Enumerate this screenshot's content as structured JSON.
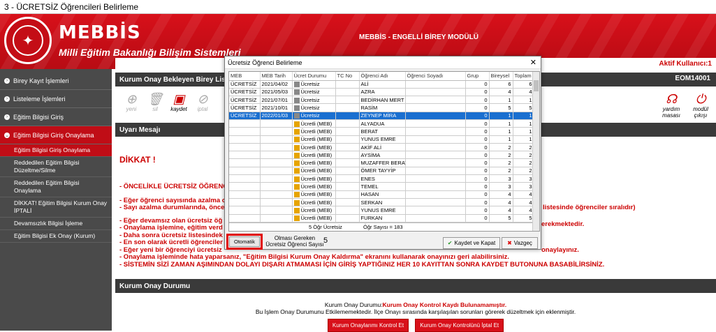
{
  "window": {
    "title": "3 - ÜCRETSİZ Öğrencileri Belirleme"
  },
  "header": {
    "brand": "MEBBİS",
    "subtitle": "Milli Eğitim Bakanlığı Bilişim Sistemleri",
    "module": "MEBBİS - ENGELLİ BİREY MODÜLÜ",
    "active_user": "Aktif Kullanıcı:1",
    "colors": {
      "header": "#d8101a",
      "sidebar": "#4a4a4a",
      "accent": "#c00d16"
    }
  },
  "sidebar": {
    "items": [
      {
        "label": "Birey Kayıt İşlemleri",
        "icon": "arrow-right-icon"
      },
      {
        "label": "Listeleme İşlemleri",
        "icon": "arrow-right-icon"
      },
      {
        "label": "Eğitim Bilgisi Giriş",
        "icon": "arrow-right-icon"
      },
      {
        "label": "Eğitim Bilgisi Giriş Onaylama",
        "icon": "arrow-down-icon"
      }
    ],
    "subitems": [
      "Eğitim Bilgisi Giriş Onaylama",
      "Reddedilen Eğitim Bilgisi Düzeltme/Silme",
      "Reddedilen Eğitim Bilgisi Onaylama",
      "DİKKAT! Eğitim Bilgisi Kurum Onay İPTALİ",
      "Devamsızlık Bilgisi İşleme",
      "Eğitim Bilgisi Ek Onay (Kurum)"
    ]
  },
  "main": {
    "panel_title": "Kurum Onay Bekleyen Birey Listesi",
    "eom_code": "EOM14001",
    "toolbar": {
      "new": "yeni",
      "delete": "sil",
      "save": "kaydet",
      "cancel": "iptal",
      "help": "yardım masası",
      "exit": "modül çıkışı"
    },
    "warning_title": "Uyarı Mesajı",
    "dikkat": "DİKKAT !",
    "warnings": [
      "- ÖNCELİKLE ÜCRETSİZ ÖĞRENC",
      "- Eğer öğrenci sayısında azalma o",
      "- Sayı azalma durumlarında, önce",
      "- Eğer devamsız olan ücretsiz öğ",
      "- Onaylama işlemine, eğitim verd",
      "- Daha sonra ücretsiz listesindek",
      "- En son olarak ücretli öğrenciler",
      "- Eğer yeni bir öğrenciyi ücretsiz",
      "- Onaylama işleminde hata yaparsanız, \"Eğitim Bilgisi Kurum Onay Kaldırma\" ekranını kullanarak onayınızı geri alabilirsiniz.",
      "- SİSTEMİN SİZİ ZAMAN AŞIMINDAN DOLAYI DIŞARI ATMAMASI İÇİN GİRİŞ YAPTIĞINIZ HER 10 KAYITTAN SONRA KAYDET BUTONUNA BASABİLİRSİNİZ."
    ],
    "warnings_right": [
      "listesinde öğrenciler sıralıdır)",
      "erekmektedir.",
      "onaylayınız."
    ],
    "approval": {
      "title": "Kurum Onay Durumu",
      "status_prefix": "Kurum Onay Durumu:",
      "status": "Kurum Onay Kontrol Kaydı Bulunamamıştır.",
      "note": "Bu İşlem Onay Durumunu Etkilememektedir. İlçe Onayı sırasında karşılaşılan sorunları görerek düzeltmek için eklenmiştir.",
      "btn_check": "Kurum Onaylarımı Kontrol Et",
      "btn_cancel": "Kurum Onay Kontrolünü İptal Et"
    }
  },
  "dialog": {
    "title": "Ücretsiz Öğrenci Belirleme",
    "columns": [
      "MEB",
      "MEB Tarih",
      "Ücret Durumu",
      "TC No",
      "Öğrenci Adı",
      "Öğrenci Soyadı",
      "Grup",
      "Bireysel",
      "Toplam"
    ],
    "rows": [
      {
        "meb": "ÜCRETSİZ",
        "date": "2021/04/02",
        "status": "Ücretsiz",
        "name": "ALİ",
        "g": "0",
        "b": "6",
        "t": "6",
        "paid": false
      },
      {
        "meb": "ÜCRETSİZ",
        "date": "2021/05/03",
        "status": "Ücretsiz",
        "name": "AZRA",
        "g": "0",
        "b": "4",
        "t": "4",
        "paid": false
      },
      {
        "meb": "ÜCRETSİZ",
        "date": "2021/07/01",
        "status": "Ücretsiz",
        "name": "BEDİRHAN MERT",
        "g": "0",
        "b": "1",
        "t": "1",
        "paid": false
      },
      {
        "meb": "ÜCRETSİZ",
        "date": "2021/10/01",
        "status": "Ücretsiz",
        "name": "RASİM",
        "g": "0",
        "b": "5",
        "t": "5",
        "paid": false
      },
      {
        "meb": "ÜCRETSİZ",
        "date": "2022/01/03",
        "status": "Ücretsiz",
        "name": "ZEYNEP MİRA",
        "g": "0",
        "b": "1",
        "t": "1",
        "paid": false,
        "selected": true
      },
      {
        "meb": "",
        "date": "",
        "status": "Ücretli (MEB)",
        "name": "ALYADUA",
        "g": "0",
        "b": "1",
        "t": "1",
        "paid": true
      },
      {
        "meb": "",
        "date": "",
        "status": "Ücretli (MEB)",
        "name": "BERAT",
        "g": "0",
        "b": "1",
        "t": "1",
        "paid": true
      },
      {
        "meb": "",
        "date": "",
        "status": "Ücretli (MEB)",
        "name": "YUNUS EMRE",
        "g": "0",
        "b": "1",
        "t": "1",
        "paid": true
      },
      {
        "meb": "",
        "date": "",
        "status": "Ücretli (MEB)",
        "name": "AKİF ALİ",
        "g": "0",
        "b": "2",
        "t": "2",
        "paid": true
      },
      {
        "meb": "",
        "date": "",
        "status": "Ücretli (MEB)",
        "name": "AYSİMA",
        "g": "0",
        "b": "2",
        "t": "2",
        "paid": true
      },
      {
        "meb": "",
        "date": "",
        "status": "Ücretli (MEB)",
        "name": "MUZAFFER BERAT",
        "g": "0",
        "b": "2",
        "t": "2",
        "paid": true
      },
      {
        "meb": "",
        "date": "",
        "status": "Ücretli (MEB)",
        "name": "ÖMER TAYYİP",
        "g": "0",
        "b": "2",
        "t": "2",
        "paid": true
      },
      {
        "meb": "",
        "date": "",
        "status": "Ücretli (MEB)",
        "name": "ENES",
        "g": "0",
        "b": "3",
        "t": "3",
        "paid": true
      },
      {
        "meb": "",
        "date": "",
        "status": "Ücretli (MEB)",
        "name": "TEMEL",
        "g": "0",
        "b": "3",
        "t": "3",
        "paid": true
      },
      {
        "meb": "",
        "date": "",
        "status": "Ücretli (MEB)",
        "name": "HASAN",
        "g": "0",
        "b": "4",
        "t": "4",
        "paid": true
      },
      {
        "meb": "",
        "date": "",
        "status": "Ücretli (MEB)",
        "name": "SERKAN",
        "g": "0",
        "b": "4",
        "t": "4",
        "paid": true
      },
      {
        "meb": "",
        "date": "",
        "status": "Ücretli (MEB)",
        "name": "YUNUS EMRE",
        "g": "0",
        "b": "4",
        "t": "4",
        "paid": true
      },
      {
        "meb": "",
        "date": "",
        "status": "Ücretli (MEB)",
        "name": "FURKAN",
        "g": "0",
        "b": "5",
        "t": "5",
        "paid": true
      }
    ],
    "summary_free": "5 Öğr Ücretsiz",
    "summary_count": "Öğr Sayısı = 183",
    "otomatik": "Otomatik",
    "required_label": "Olması Gereken Ücretsiz Öğrenci Sayısı",
    "required_value": "5",
    "save": "Kaydet ve Kapat",
    "cancel": "Vazgeç"
  }
}
